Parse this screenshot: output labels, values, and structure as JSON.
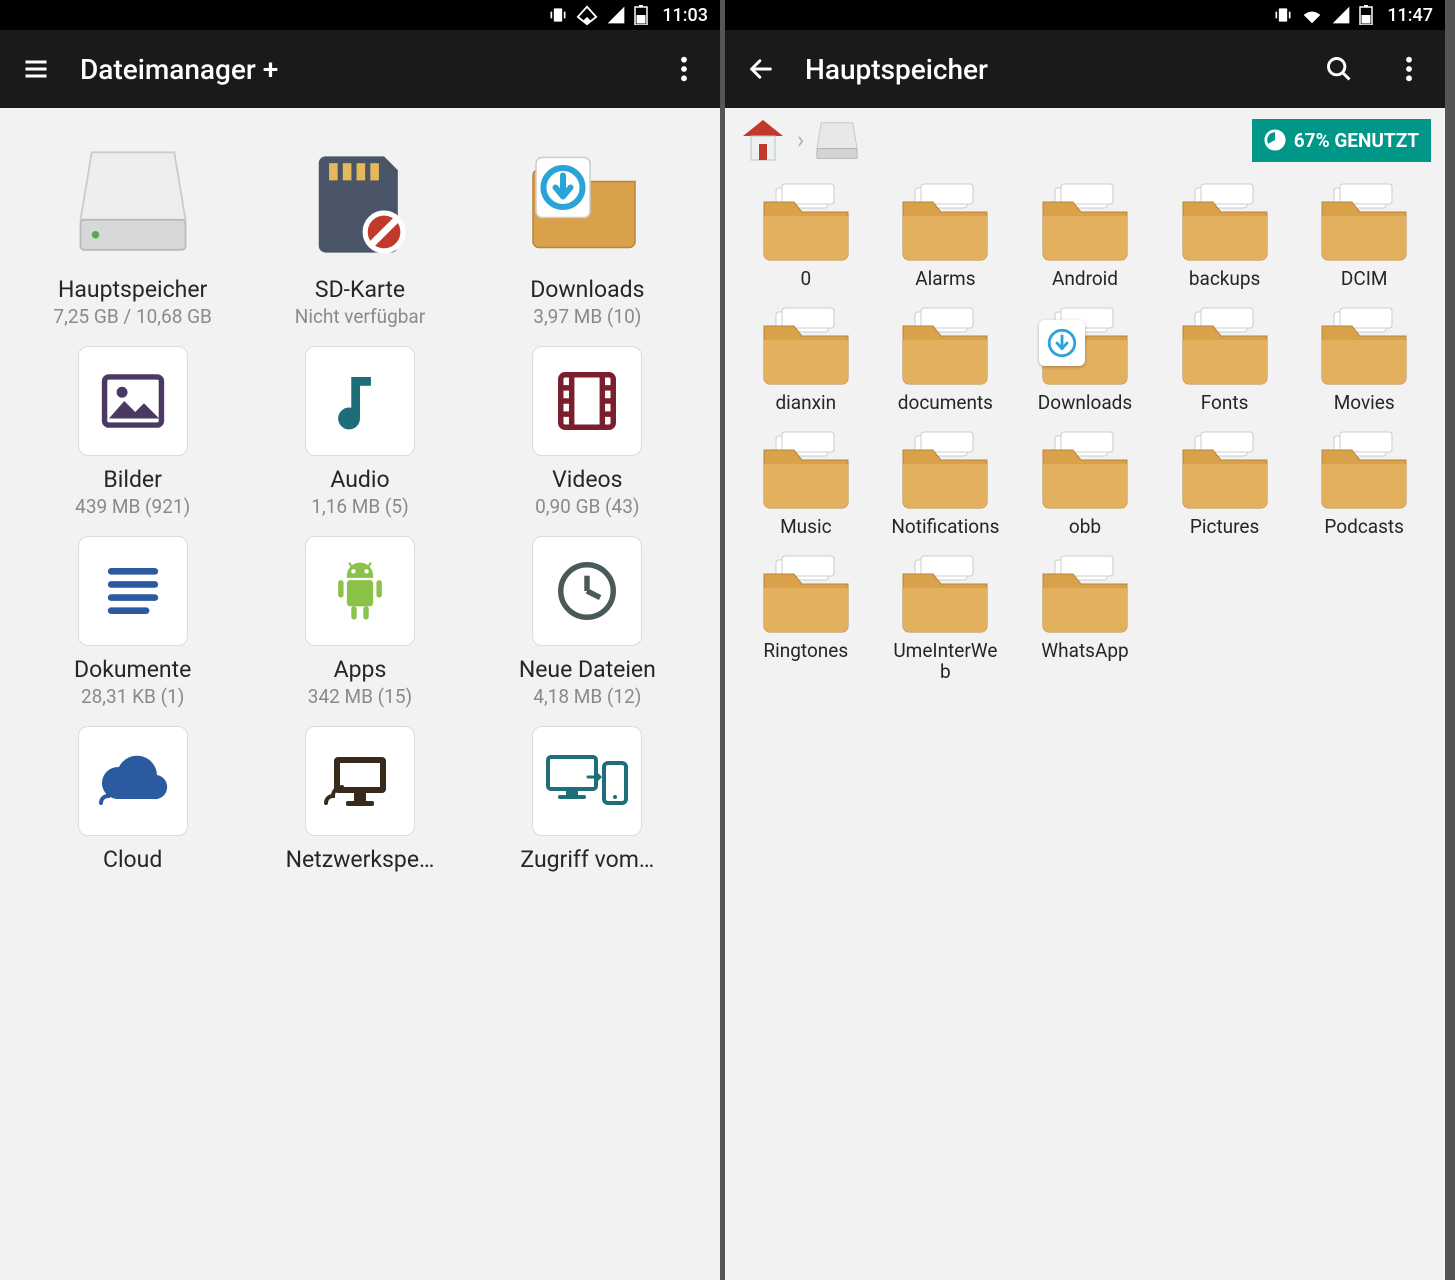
{
  "left": {
    "status_time": "11:03",
    "app_title": "Dateimanager +",
    "categories": [
      {
        "id": "main-storage",
        "label": "Hauptspeicher",
        "sub": "7,25 GB / 10,68 GB",
        "icon": "drive",
        "boxed": false
      },
      {
        "id": "sd-card",
        "label": "SD-Karte",
        "sub": "Nicht verfügbar",
        "icon": "sdcard",
        "boxed": false
      },
      {
        "id": "downloads",
        "label": "Downloads",
        "sub": "3,97 MB (10)",
        "icon": "folder_dl",
        "boxed": false
      },
      {
        "id": "images",
        "label": "Bilder",
        "sub": "439 MB (921)",
        "icon": "image",
        "boxed": true
      },
      {
        "id": "audio",
        "label": "Audio",
        "sub": "1,16 MB (5)",
        "icon": "audio",
        "boxed": true
      },
      {
        "id": "videos",
        "label": "Videos",
        "sub": "0,90 GB (43)",
        "icon": "video",
        "boxed": true
      },
      {
        "id": "documents",
        "label": "Dokumente",
        "sub": "28,31 KB (1)",
        "icon": "doc",
        "boxed": true
      },
      {
        "id": "apps",
        "label": "Apps",
        "sub": "342 MB (15)",
        "icon": "android",
        "boxed": true
      },
      {
        "id": "new-files",
        "label": "Neue Dateien",
        "sub": "4,18 MB (12)",
        "icon": "clock",
        "boxed": true
      },
      {
        "id": "cloud",
        "label": "Cloud",
        "sub": "",
        "icon": "cloud",
        "boxed": true
      },
      {
        "id": "network",
        "label": "Netzwerkspe…",
        "sub": "",
        "icon": "netmon",
        "boxed": true
      },
      {
        "id": "pc-access",
        "label": "Zugriff vom…",
        "sub": "",
        "icon": "pcphone",
        "boxed": true
      }
    ]
  },
  "right": {
    "status_time": "11:47",
    "app_title": "Hauptspeicher",
    "usage_label": "67% GENUTZT",
    "folders": [
      {
        "label": "0",
        "type": "plain"
      },
      {
        "label": "Alarms",
        "type": "plain"
      },
      {
        "label": "Android",
        "type": "plain"
      },
      {
        "label": "backups",
        "type": "plain"
      },
      {
        "label": "DCIM",
        "type": "plain"
      },
      {
        "label": "dianxin",
        "type": "plain"
      },
      {
        "label": "documents",
        "type": "plain"
      },
      {
        "label": "Downloads",
        "type": "dl"
      },
      {
        "label": "Fonts",
        "type": "plain"
      },
      {
        "label": "Movies",
        "type": "plain"
      },
      {
        "label": "Music",
        "type": "plain"
      },
      {
        "label": "Notifications",
        "type": "plain"
      },
      {
        "label": "obb",
        "type": "plain"
      },
      {
        "label": "Pictures",
        "type": "plain"
      },
      {
        "label": "Podcasts",
        "type": "plain"
      },
      {
        "label": "Ringtones",
        "type": "plain"
      },
      {
        "label": "UmeInterWeb",
        "type": "plain"
      },
      {
        "label": "WhatsApp",
        "type": "plain"
      }
    ]
  }
}
